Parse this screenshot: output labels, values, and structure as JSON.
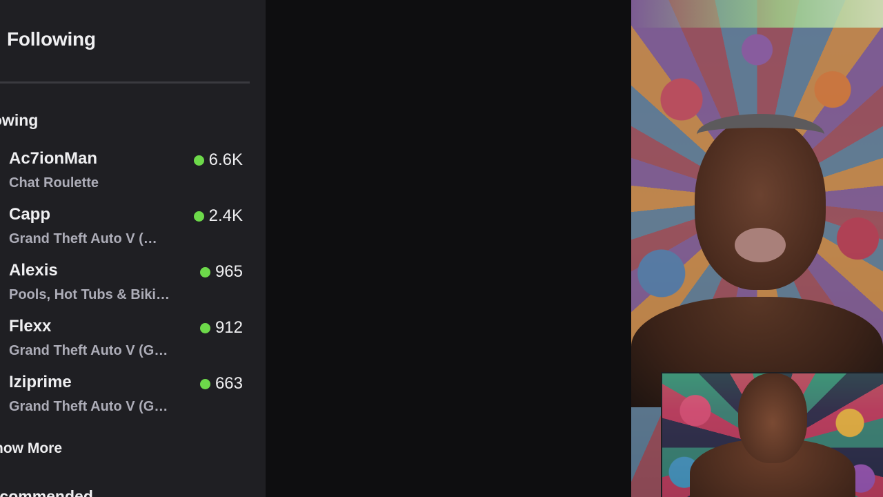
{
  "sidebar": {
    "header": "Following",
    "section_title": "Following",
    "channels": [
      {
        "name": "Ac7ionMan",
        "game": "Chat Roulette",
        "viewers": "6.6K"
      },
      {
        "name": "Capp",
        "game": "Grand Theft Auto V (…",
        "viewers": "2.4K"
      },
      {
        "name": "Alexis",
        "game": "Pools, Hot Tubs & Biki…",
        "viewers": "965"
      },
      {
        "name": "Flexx",
        "game": "Grand Theft Auto V (G…",
        "viewers": "912"
      },
      {
        "name": "Iziprime",
        "game": "Grand Theft Auto V (G…",
        "viewers": "663"
      }
    ],
    "show_more": "Show More",
    "recommended_title": "Recommended"
  },
  "colors": {
    "sidebar_bg": "#1f1f23",
    "live_dot": "#6dd94a",
    "muted_text": "#adadb8"
  }
}
